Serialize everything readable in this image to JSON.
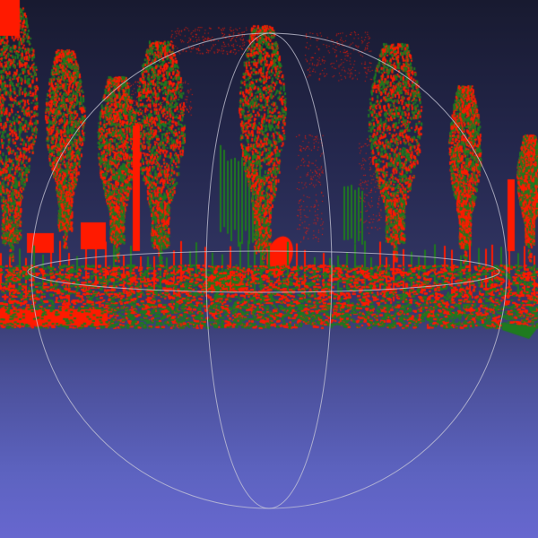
{
  "viewer": {
    "title": "",
    "background_top": "#181a30",
    "background_bottom": "#6767cf"
  },
  "point_cloud": {
    "colors": {
      "source": "#ff1a00",
      "target": "#1f7a1f"
    },
    "object": "trees",
    "tree_count": 8
  },
  "trackball": {
    "color": "#c8c8d8",
    "visible": true
  }
}
